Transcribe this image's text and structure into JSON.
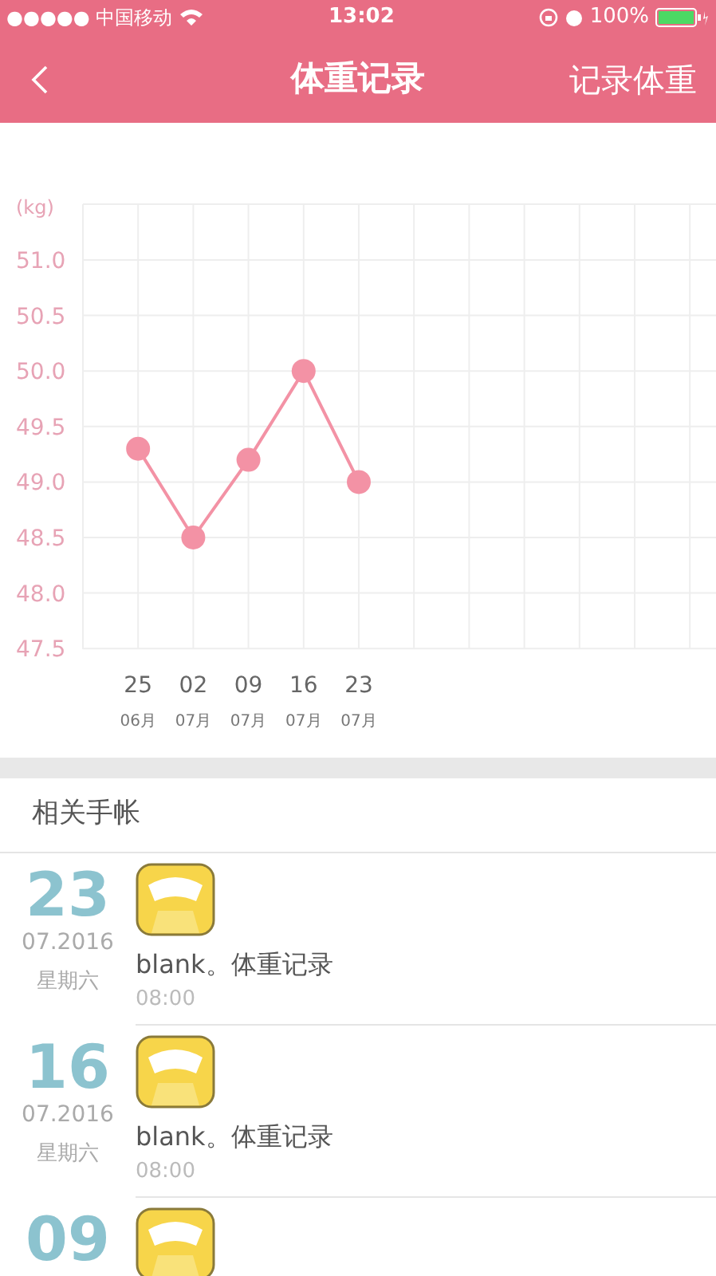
{
  "status_bar": {
    "carrier": "●●●●● 中国移动",
    "time": "13:02",
    "battery": "100%"
  },
  "nav": {
    "title": "体重记录",
    "action": "记录体重"
  },
  "chart_data": {
    "type": "line",
    "ylabel": "(kg)",
    "categories": [
      "25\n06月",
      "02\n07月",
      "09\n07月",
      "16\n07月",
      "23\n07月"
    ],
    "ylim": [
      47.5,
      51.0
    ],
    "grid": true,
    "yticks": [
      {
        "value": 51,
        "label": "51.0"
      },
      {
        "value": 50.5,
        "label": "50.5"
      },
      {
        "value": 50,
        "label": "50.0"
      },
      {
        "value": 49.5,
        "label": "49.5"
      },
      {
        "value": 49,
        "label": "49.0"
      },
      {
        "value": 48.5,
        "label": "48.5"
      },
      {
        "value": 48,
        "label": "48.0"
      },
      {
        "value": 47.5,
        "label": "47.5"
      }
    ],
    "series": [
      {
        "color": "#f392a5",
        "marker": "circle",
        "values": [
          49.3,
          48.5,
          49.2,
          50.0,
          49.0
        ]
      }
    ]
  },
  "section_title": "相关手帐",
  "entries": [
    {
      "day": "23",
      "month_year": "07.2016",
      "weekday": "星期六",
      "title": "blank。体重记录",
      "time": "08:00"
    },
    {
      "day": "16",
      "month_year": "07.2016",
      "weekday": "星期六",
      "title": "blank。体重记录",
      "time": "08:00"
    },
    {
      "day": "09"
    }
  ]
}
